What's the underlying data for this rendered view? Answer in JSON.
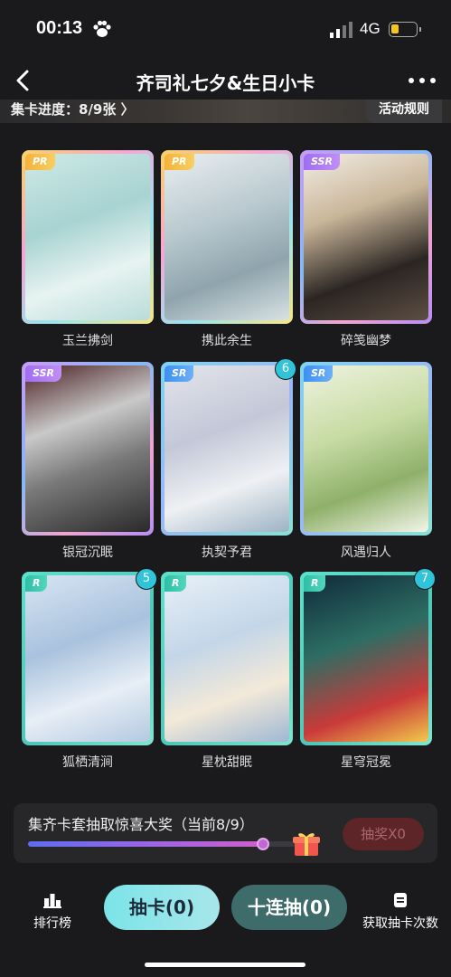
{
  "status": {
    "time": "00:13",
    "network": "4G",
    "battery_color": "#f4c51c",
    "battery_level": 0.3
  },
  "nav": {
    "title": "齐司礼七夕&生日小卡",
    "back_icon": "chevron-left-icon",
    "more_icon": "more-dots-icon"
  },
  "progress": {
    "text": "集卡进度：8/9张 〉",
    "rules_label": "活动规则"
  },
  "cards": [
    {
      "name": "玉兰拂剑",
      "rarity": "PR",
      "count": null
    },
    {
      "name": "携此余生",
      "rarity": "PR",
      "count": null
    },
    {
      "name": "碎笺幽梦",
      "rarity": "SSR",
      "count": null
    },
    {
      "name": "银冠沉眠",
      "rarity": "SSR",
      "count": null
    },
    {
      "name": "执契予君",
      "rarity": "SR",
      "count": "6"
    },
    {
      "name": "风遇归人",
      "rarity": "SR",
      "count": null
    },
    {
      "name": "狐栖清涧",
      "rarity": "R",
      "count": "5"
    },
    {
      "name": "星枕甜眠",
      "rarity": "R",
      "count": null
    },
    {
      "name": "星穹冠冕",
      "rarity": "R",
      "count": "7"
    }
  ],
  "reward": {
    "text": "集齐卡套抽取惊喜大奖（当前8/9）",
    "progress_fraction": 0.889,
    "button_label": "抽奖X0"
  },
  "bottom": {
    "rank_label": "排行榜",
    "draw_label": "抽卡(0)",
    "draw10_label": "十连抽(0)",
    "obtain_label": "获取抽卡次数"
  },
  "colors": {
    "accent_cyan": "#7be4e8",
    "teal_button": "#3e6c6a",
    "count_badge": "#2fc4d9"
  }
}
